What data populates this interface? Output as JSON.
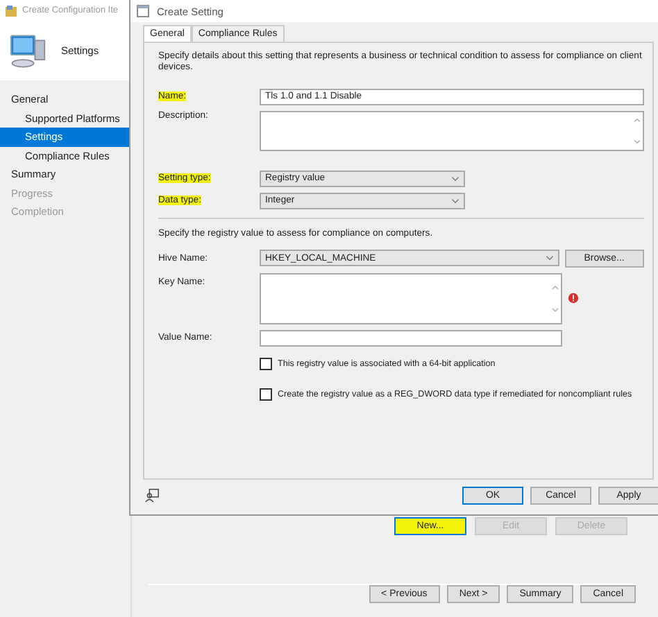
{
  "wizard": {
    "title": "Create Configuration Ite",
    "header": "Settings",
    "nav": [
      {
        "label": "General",
        "selected": false,
        "disabled": false,
        "children": [
          {
            "label": "Supported Platforms",
            "selected": false,
            "disabled": false
          },
          {
            "label": "Settings",
            "selected": true,
            "disabled": false
          },
          {
            "label": "Compliance Rules",
            "selected": false,
            "disabled": false
          }
        ]
      },
      {
        "label": "Summary",
        "selected": false,
        "disabled": false
      },
      {
        "label": "Progress",
        "selected": false,
        "disabled": true
      },
      {
        "label": "Completion",
        "selected": false,
        "disabled": true
      }
    ],
    "list_buttons": [
      {
        "label": "New...",
        "disabled": false,
        "highlighted": true
      },
      {
        "label": "Edit",
        "disabled": true,
        "highlighted": false
      },
      {
        "label": "Delete",
        "disabled": true,
        "highlighted": false
      }
    ],
    "nav_buttons": [
      "< Previous",
      "Next >",
      "Summary",
      "Cancel"
    ]
  },
  "dialog": {
    "title": "Create Setting",
    "tabs": [
      {
        "label": "General",
        "selected": true
      },
      {
        "label": "Compliance Rules",
        "selected": false
      }
    ],
    "intro": "Specify details about this setting that represents a business or technical condition to assess for compliance on client devices.",
    "general_fields": [
      {
        "kind": "text",
        "label": "Name:",
        "highlighted": true,
        "value": "Tls 1.0 and 1.1 Disable"
      },
      {
        "kind": "textarea",
        "label": "Description:",
        "highlighted": false
      },
      {
        "kind": "select",
        "label": "Setting type:",
        "highlighted": true,
        "value": "Registry value"
      },
      {
        "kind": "select",
        "label": "Data type:",
        "highlighted": true,
        "value": "Integer"
      }
    ],
    "registry_intro": "Specify the registry value to assess for compliance on computers.",
    "registry_fields": [
      {
        "kind": "select",
        "label": "Hive Name:",
        "value": "HKEY_LOCAL_MACHINE",
        "button": "Browse..."
      },
      {
        "kind": "textarea",
        "label": "Key Name:",
        "error": true
      },
      {
        "kind": "text",
        "label": "Value Name:"
      }
    ],
    "checkboxes": [
      {
        "label": "This registry value is associated with a 64-bit application",
        "checked": false
      },
      {
        "label": "Create the registry value as a REG_DWORD data type if remediated for noncompliant rules",
        "checked": false
      }
    ],
    "buttons": [
      {
        "label": "OK",
        "default": true
      },
      {
        "label": "Cancel",
        "default": false
      },
      {
        "label": "Apply",
        "default": false
      }
    ]
  }
}
